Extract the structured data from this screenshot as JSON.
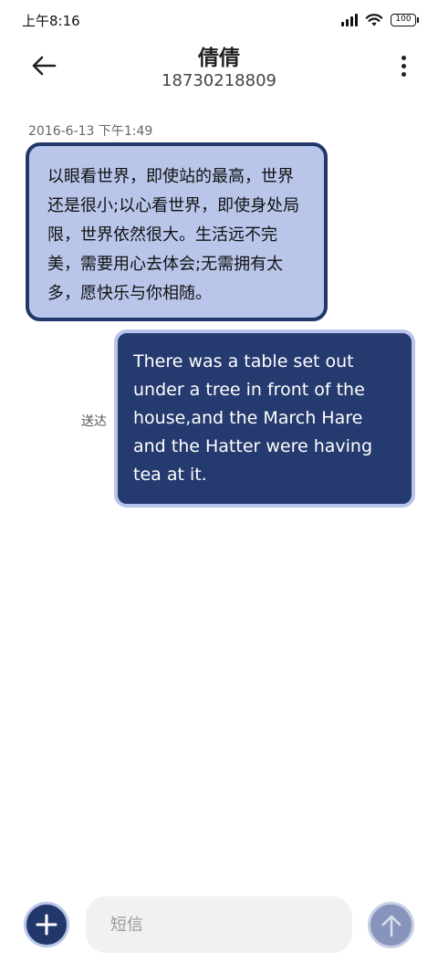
{
  "status_bar": {
    "time": "上午8:16",
    "battery": "100",
    "icons": [
      "signal-icon",
      "wifi-icon",
      "battery-icon"
    ]
  },
  "header": {
    "contact_name": "倩倩",
    "contact_number": "18730218809",
    "back_icon": "arrow-left-icon",
    "more_icon": "more-vertical-icon"
  },
  "conversation": {
    "timestamp": "2016-6-13 下午1:49",
    "messages": [
      {
        "direction": "incoming",
        "text": "以眼看世界，即使站的最高，世界还是很小;以心看世界，即使身处局限，世界依然很大。生活远不完美，需要用心去体会;无需拥有太多，愿快乐与你相随。"
      },
      {
        "direction": "outgoing",
        "status": "送达",
        "text": "There was a table set out under a tree in front of the house,and the March Hare and the Hatter were having tea at it."
      }
    ]
  },
  "compose": {
    "placeholder": "短信",
    "value": "",
    "add_icon": "plus-icon",
    "send_icon": "arrow-up-icon"
  },
  "colors": {
    "accent_dark": "#23386a",
    "accent_light": "#b9c6ea",
    "outgoing_bubble": "#253a6e",
    "send_button": "#8795bd"
  }
}
